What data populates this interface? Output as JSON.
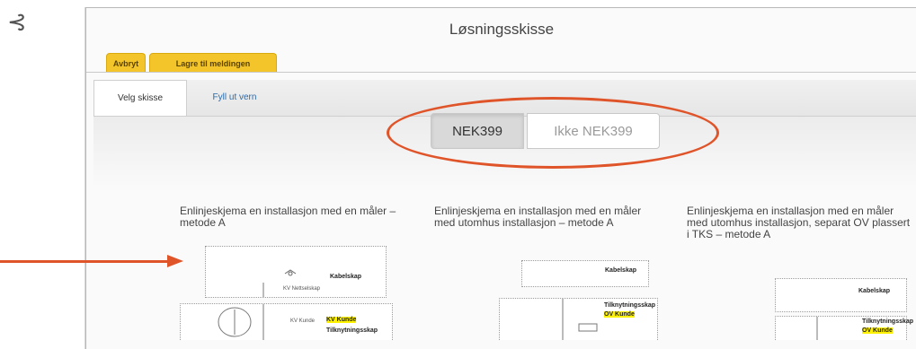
{
  "corner_glyph": "⊰",
  "window": {
    "title": "Løsningsskisse",
    "toolbar": {
      "cancel_label": "Avbryt",
      "save_label": "Lagre til meldingen"
    },
    "tabs": [
      {
        "label": "Velg skisse",
        "active": true
      },
      {
        "label": "Fyll ut vern",
        "active": false
      }
    ],
    "toggle": {
      "options": [
        {
          "label": "NEK399",
          "selected": true
        },
        {
          "label": "Ikke NEK399",
          "selected": false
        }
      ]
    }
  },
  "sketches": [
    {
      "title": "Enlinjeskjema en installasjon med en måler – metode A",
      "labels": {
        "kabelskap": "Kabelskap",
        "kv_kunde": "KV Kunde",
        "tilknytningsskap": "Tilknytningsskap",
        "kv_nettselskap": "KV Nettselskap",
        "kv_kunde_small": "KV Kunde"
      }
    },
    {
      "title": "Enlinjeskjema en installasjon med en måler med utomhus installasjon – metode A",
      "labels": {
        "kabelskap": "Kabelskap",
        "tilknytningsskap": "Tilknytningsskap",
        "ov_kunde": "OV Kunde"
      }
    },
    {
      "title": "Enlinjeskjema en installasjon med en måler med utomhus installasjon, separat OV plassert i TKS – metode A",
      "labels": {
        "kabelskap": "Kabelskap",
        "tilknytningsskap": "Tilknytningsskap",
        "ov_kunde": "OV Kunde"
      }
    }
  ],
  "colors": {
    "accent": "#e0542a",
    "button_yellow": "#f4c52b",
    "tab_link": "#2a6aa8",
    "highlight": "#fff200"
  }
}
